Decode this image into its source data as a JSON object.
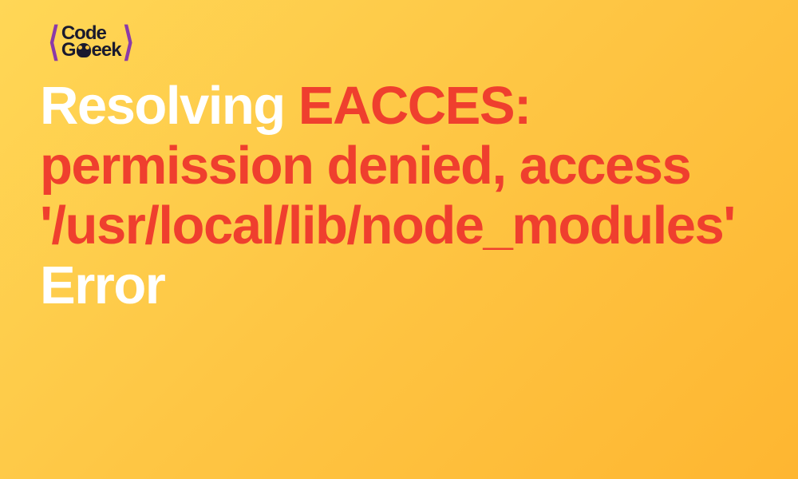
{
  "logo": {
    "line1": "Code",
    "line2_g": "G",
    "line2_eek": "eek"
  },
  "title": {
    "word_resolving": "Resolving ",
    "word_eacces": "EACCES: permission denied, access '/usr/local/lib/node_modules'",
    "word_error": " Error"
  }
}
